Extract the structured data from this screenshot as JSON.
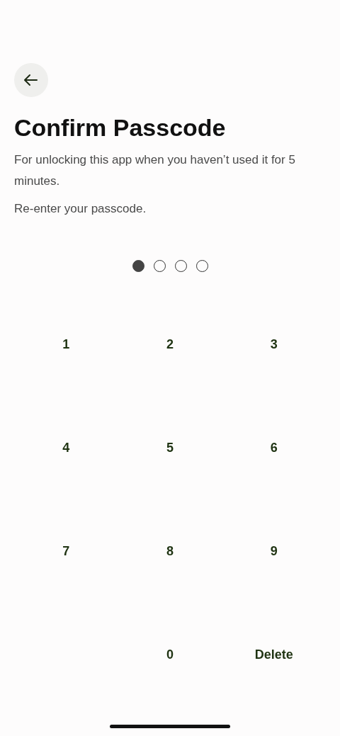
{
  "title": "Confirm Passcode",
  "description": "For unlocking this app when you haven’t used it for 5 minutes.",
  "instruction": "Re-enter your passcode.",
  "passcode_dots": [
    {
      "filled": true
    },
    {
      "filled": false
    },
    {
      "filled": false
    },
    {
      "filled": false
    }
  ],
  "keypad": [
    {
      "kind": "key",
      "label": "1"
    },
    {
      "kind": "key",
      "label": "2"
    },
    {
      "kind": "key",
      "label": "3"
    },
    {
      "kind": "key",
      "label": "4"
    },
    {
      "kind": "key",
      "label": "5"
    },
    {
      "kind": "key",
      "label": "6"
    },
    {
      "kind": "key",
      "label": "7"
    },
    {
      "kind": "key",
      "label": "8"
    },
    {
      "kind": "key",
      "label": "9"
    },
    {
      "kind": "blank"
    },
    {
      "kind": "key",
      "label": "0"
    },
    {
      "kind": "delete",
      "label": "Delete"
    }
  ]
}
